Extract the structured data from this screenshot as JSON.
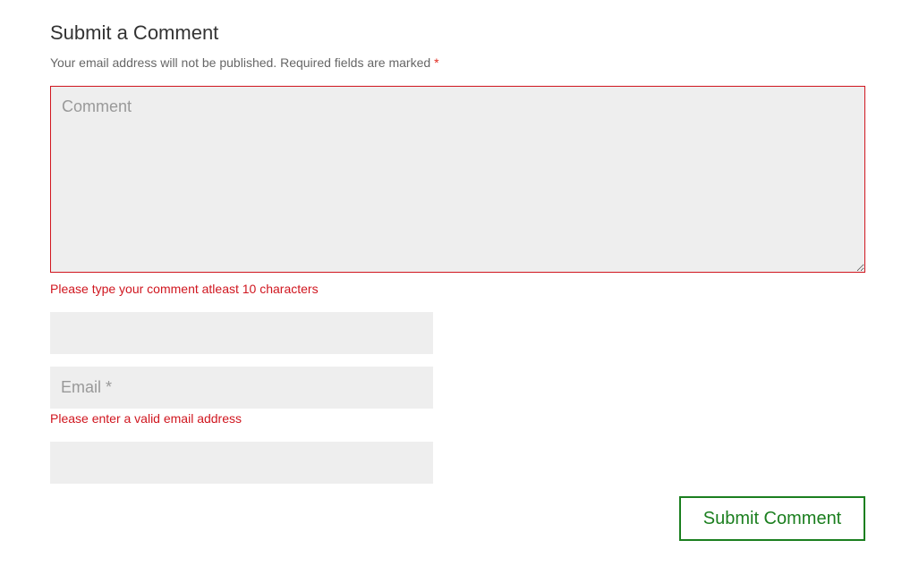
{
  "form": {
    "title": "Submit a Comment",
    "notice_text": "Your email address will not be published. Required fields are marked ",
    "notice_required_mark": "*",
    "comment": {
      "placeholder": "Comment",
      "value": "",
      "error": "Please type your comment atleast 10 characters"
    },
    "name": {
      "placeholder": "",
      "value": ""
    },
    "email": {
      "placeholder": "Email *",
      "value": "",
      "error": "Please enter a valid email address"
    },
    "website": {
      "placeholder": "",
      "value": ""
    },
    "submit_label": "Submit Comment"
  },
  "colors": {
    "error": "#d0161f",
    "field_background": "#eeeeee",
    "submit_accent": "#1b7f1f",
    "heading": "#333333",
    "muted_text": "#666666"
  }
}
